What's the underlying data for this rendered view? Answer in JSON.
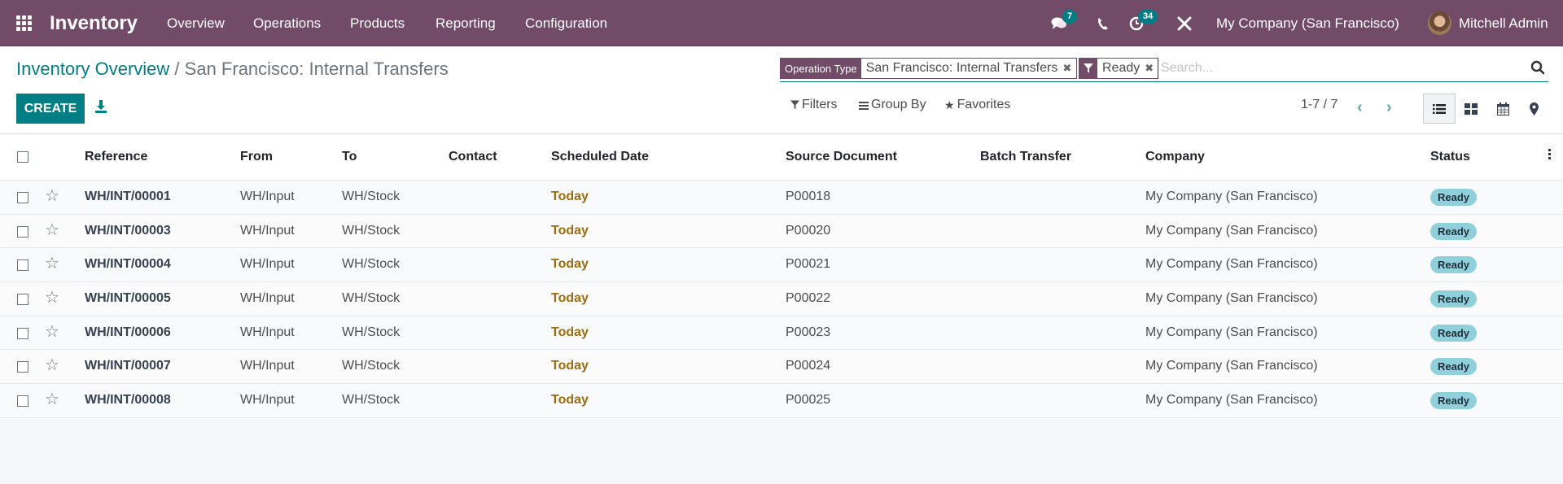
{
  "navbar": {
    "app_title": "Inventory",
    "menu": [
      "Overview",
      "Operations",
      "Products",
      "Reporting",
      "Configuration"
    ],
    "messages_count": "7",
    "activities_count": "34",
    "company": "My Company (San Francisco)",
    "user": "Mitchell Admin"
  },
  "breadcrumb": {
    "parent": "Inventory Overview",
    "separator": "/",
    "current": "San Francisco: Internal Transfers"
  },
  "toolbar": {
    "create_label": "CREATE"
  },
  "search": {
    "facets": [
      {
        "label": "Operation Type",
        "value": "San Francisco: Internal Transfers"
      },
      {
        "label_icon": "filter-icon",
        "value": "Ready"
      }
    ],
    "placeholder": "Search...",
    "value": ""
  },
  "filters": {
    "filters_label": "Filters",
    "group_by_label": "Group By",
    "favorites_label": "Favorites"
  },
  "pager": {
    "range": "1-7 / 7"
  },
  "views": [
    "list",
    "kanban",
    "calendar",
    "map"
  ],
  "active_view": "list",
  "table": {
    "columns": [
      "Reference",
      "From",
      "To",
      "Contact",
      "Scheduled Date",
      "Source Document",
      "Batch Transfer",
      "Company",
      "Status"
    ],
    "rows": [
      {
        "reference": "WH/INT/00001",
        "from": "WH/Input",
        "to": "WH/Stock",
        "contact": "",
        "scheduled": "Today",
        "source": "P00018",
        "batch": "",
        "company": "My Company (San Francisco)",
        "status": "Ready"
      },
      {
        "reference": "WH/INT/00003",
        "from": "WH/Input",
        "to": "WH/Stock",
        "contact": "",
        "scheduled": "Today",
        "source": "P00020",
        "batch": "",
        "company": "My Company (San Francisco)",
        "status": "Ready"
      },
      {
        "reference": "WH/INT/00004",
        "from": "WH/Input",
        "to": "WH/Stock",
        "contact": "",
        "scheduled": "Today",
        "source": "P00021",
        "batch": "",
        "company": "My Company (San Francisco)",
        "status": "Ready"
      },
      {
        "reference": "WH/INT/00005",
        "from": "WH/Input",
        "to": "WH/Stock",
        "contact": "",
        "scheduled": "Today",
        "source": "P00022",
        "batch": "",
        "company": "My Company (San Francisco)",
        "status": "Ready"
      },
      {
        "reference": "WH/INT/00006",
        "from": "WH/Input",
        "to": "WH/Stock",
        "contact": "",
        "scheduled": "Today",
        "source": "P00023",
        "batch": "",
        "company": "My Company (San Francisco)",
        "status": "Ready"
      },
      {
        "reference": "WH/INT/00007",
        "from": "WH/Input",
        "to": "WH/Stock",
        "contact": "",
        "scheduled": "Today",
        "source": "P00024",
        "batch": "",
        "company": "My Company (San Francisco)",
        "status": "Ready"
      },
      {
        "reference": "WH/INT/00008",
        "from": "WH/Input",
        "to": "WH/Stock",
        "contact": "",
        "scheduled": "Today",
        "source": "P00025",
        "batch": "",
        "company": "My Company (San Francisco)",
        "status": "Ready"
      }
    ]
  },
  "colors": {
    "brand": "#714b67",
    "accent": "#017e84",
    "date_today": "#9c6c10",
    "status_ready": "#8fd0da"
  }
}
